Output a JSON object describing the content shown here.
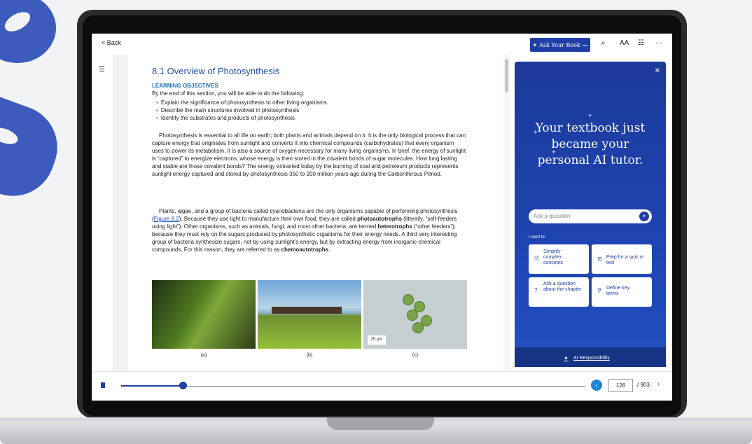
{
  "toolbar": {
    "back_label": "< Back",
    "ask_book_label": "Ask Your Book",
    "ask_book_badge": "beta",
    "search_icon": "search-icon",
    "text_size_label": "AA",
    "more_label": "···"
  },
  "article": {
    "title": "8.1 Overview of Photosynthesis",
    "objectives_heading": "LEARNING OBJECTIVES",
    "objectives_intro": "By the end of this section, you will be able to do the following:",
    "objectives": [
      "Explain the significance of photosynthesis to other living organisms",
      "Describe the main structures involved in photosynthesis",
      "Identify the substrates and products of photosynthesis"
    ],
    "para1": "Photosynthesis is essential to all life on earth; both plants and animals depend on it. It is the only biological process that can capture energy that originates from sunlight and converts it into chemical compounds (carbohydrates) that every organism uses to power its metabolism. It is also a source of oxygen necessary for many living organisms. In brief, the energy of sunlight is “captured” to energize electrons, whose energy is then stored in the covalent bonds of sugar molecules. How long lasting and stable are those covalent bonds? The energy extracted today by the burning of coal and petroleum products represents sunlight energy captured and stored by photosynthesis 350 to 200 million years ago during the Carboniferous Period.",
    "para2_a": "Plants, algae, and a group of bacteria called cyanobacteria are the only organisms capable of performing photosynthesis (",
    "para2_link": "Figure 8.2",
    "para2_b": "). Because they use light to manufacture their own food, they are called ",
    "para2_bold1": "photoautotrophs",
    "para2_c": " (literally, “self-feeders using light”). Other organisms, such as animals, fungi, and most other bacteria, are termed ",
    "para2_bold2": "heterotrophs",
    "para2_d": " (“other feeders”), because they must rely on the sugars produced by photosynthetic organisms for their energy needs. A third very interesting group of bacteria synthesize sugars, not by using sunlight’s energy, but by extracting energy from inorganic chemical compounds. For this reason, they are referred to as ",
    "para2_bold3": "chemoautotrophs",
    "para2_e": ".",
    "figure_captions": [
      "(a)",
      "(b)",
      "(c)"
    ],
    "scale_label": "25 μm"
  },
  "ai_panel": {
    "headline": "Your textbook just became your personal AI tutor.",
    "input_placeholder": "Ask a question",
    "i_want_to": "I want to:",
    "options": [
      {
        "label": "Simplify complex concepts",
        "icon": "document-icon"
      },
      {
        "label": "Prep for a quiz or test",
        "icon": "check-circle-icon"
      },
      {
        "label": "Ask a question about the chapter",
        "icon": "question-circle-icon"
      },
      {
        "label": "Define key terms",
        "icon": "book-search-icon"
      }
    ],
    "footer_link": "AI Responsibility",
    "accent": "#1f3fa6"
  },
  "pager": {
    "current_page": "126",
    "total_pages": "/ 903",
    "progress": 0.14
  }
}
